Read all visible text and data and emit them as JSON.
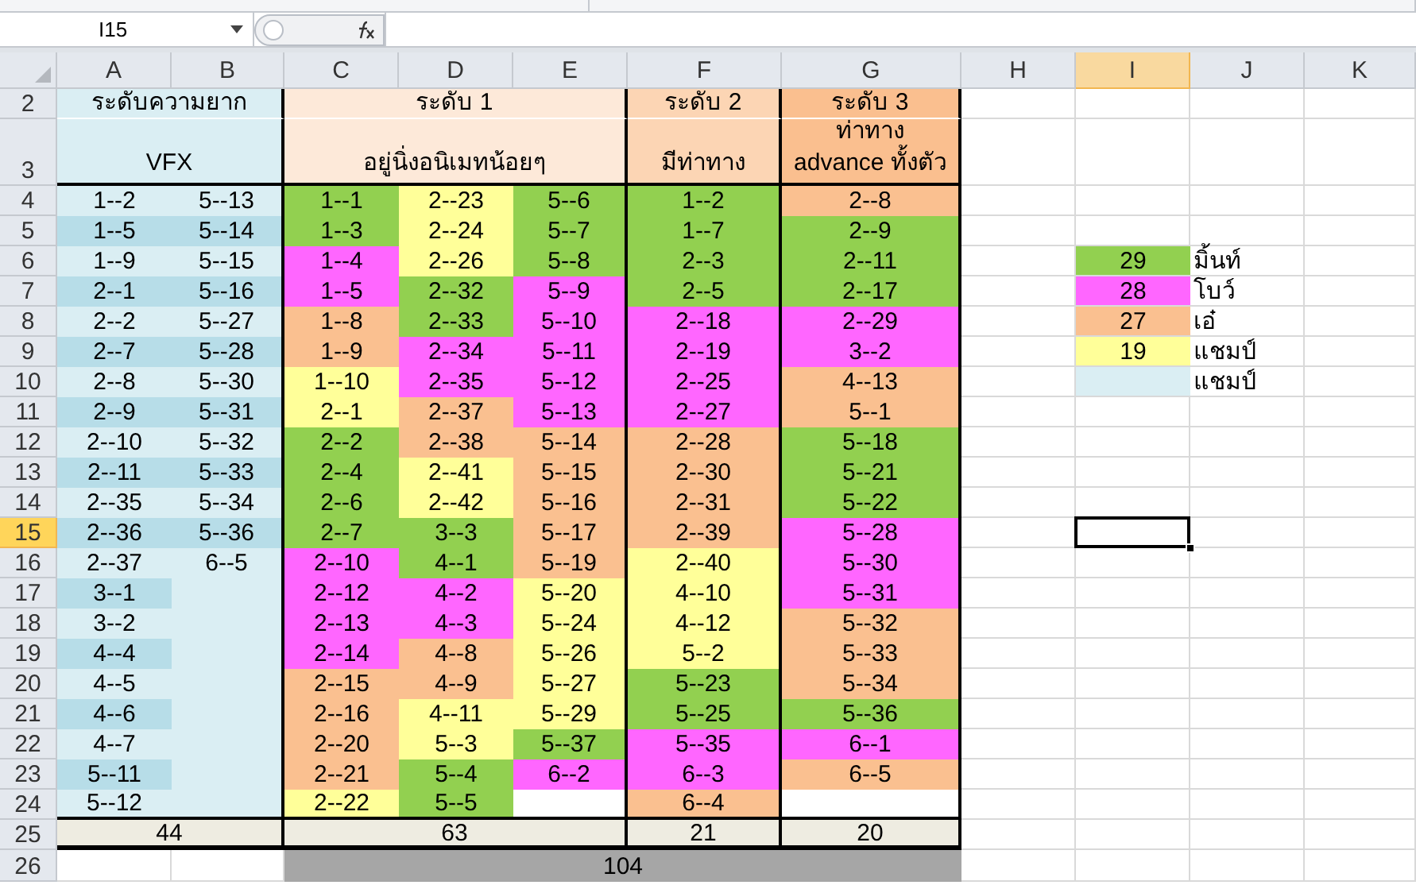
{
  "name_box": "I15",
  "column_headers": [
    {
      "label": "A",
      "selected": false
    },
    {
      "label": "B",
      "selected": false
    },
    {
      "label": "C",
      "selected": false
    },
    {
      "label": "D",
      "selected": false
    },
    {
      "label": "E",
      "selected": false
    },
    {
      "label": "F",
      "selected": false
    },
    {
      "label": "G",
      "selected": false
    },
    {
      "label": "H",
      "selected": false
    },
    {
      "label": "I",
      "selected": true
    },
    {
      "label": "J",
      "selected": false
    },
    {
      "label": "K",
      "selected": false
    }
  ],
  "row_headers": [
    {
      "label": "2",
      "selected": false
    },
    {
      "label": "3",
      "selected": false
    },
    {
      "label": "4",
      "selected": false
    },
    {
      "label": "5",
      "selected": false
    },
    {
      "label": "6",
      "selected": false
    },
    {
      "label": "7",
      "selected": false
    },
    {
      "label": "8",
      "selected": false
    },
    {
      "label": "9",
      "selected": false
    },
    {
      "label": "10",
      "selected": false
    },
    {
      "label": "11",
      "selected": false
    },
    {
      "label": "12",
      "selected": false
    },
    {
      "label": "13",
      "selected": false
    },
    {
      "label": "14",
      "selected": false
    },
    {
      "label": "15",
      "selected": true
    },
    {
      "label": "16",
      "selected": false
    },
    {
      "label": "17",
      "selected": false
    },
    {
      "label": "18",
      "selected": false
    },
    {
      "label": "19",
      "selected": false
    },
    {
      "label": "20",
      "selected": false
    },
    {
      "label": "21",
      "selected": false
    },
    {
      "label": "22",
      "selected": false
    },
    {
      "label": "23",
      "selected": false
    },
    {
      "label": "24",
      "selected": false
    },
    {
      "label": "25",
      "selected": false
    },
    {
      "label": "26",
      "selected": false
    }
  ],
  "sections": [
    {
      "title": "ระดับความยาก",
      "subtitle": "VFX",
      "color": "#daeef3",
      "total": "44",
      "columns": [
        {
          "cells": [
            {
              "text": "1--2",
              "color": "#daeef3"
            },
            {
              "text": "1--5",
              "color": "#b7dde8"
            },
            {
              "text": "1--9",
              "color": "#daeef3"
            },
            {
              "text": "2--1",
              "color": "#b7dde8"
            },
            {
              "text": "2--2",
              "color": "#daeef3"
            },
            {
              "text": "2--7",
              "color": "#b7dde8"
            },
            {
              "text": "2--8",
              "color": "#daeef3"
            },
            {
              "text": "2--9",
              "color": "#b7dde8"
            },
            {
              "text": "2--10",
              "color": "#daeef3"
            },
            {
              "text": "2--11",
              "color": "#b7dde8"
            },
            {
              "text": "2--35",
              "color": "#daeef3"
            },
            {
              "text": "2--36",
              "color": "#b7dde8"
            },
            {
              "text": "2--37",
              "color": "#daeef3"
            },
            {
              "text": "3--1",
              "color": "#b7dde8"
            },
            {
              "text": "3--2",
              "color": "#daeef3"
            },
            {
              "text": "4--4",
              "color": "#b7dde8"
            },
            {
              "text": "4--5",
              "color": "#daeef3"
            },
            {
              "text": "4--6",
              "color": "#b7dde8"
            },
            {
              "text": "4--7",
              "color": "#daeef3"
            },
            {
              "text": "5--11",
              "color": "#b7dde8"
            },
            {
              "text": "5--12",
              "color": "#daeef3"
            }
          ]
        },
        {
          "cells": [
            {
              "text": "5--13",
              "color": "#daeef3"
            },
            {
              "text": "5--14",
              "color": "#b7dde8"
            },
            {
              "text": "5--15",
              "color": "#daeef3"
            },
            {
              "text": "5--16",
              "color": "#b7dde8"
            },
            {
              "text": "5--27",
              "color": "#daeef3"
            },
            {
              "text": "5--28",
              "color": "#b7dde8"
            },
            {
              "text": "5--30",
              "color": "#daeef3"
            },
            {
              "text": "5--31",
              "color": "#b7dde8"
            },
            {
              "text": "5--32",
              "color": "#daeef3"
            },
            {
              "text": "5--33",
              "color": "#b7dde8"
            },
            {
              "text": "5--34",
              "color": "#daeef3"
            },
            {
              "text": "5--36",
              "color": "#b7dde8"
            },
            {
              "text": "6--5",
              "color": "#daeef3"
            },
            {
              "color": "#daeef3"
            },
            {
              "color": "#daeef3"
            },
            {
              "color": "#daeef3"
            },
            {
              "color": "#daeef3"
            },
            {
              "color": "#daeef3"
            },
            {
              "color": "#daeef3"
            },
            {
              "color": "#daeef3"
            },
            {
              "color": "#daeef3"
            }
          ]
        }
      ]
    },
    {
      "title": "ระดับ 1",
      "subtitle": "อยู่นิ่งอนิเมทน้อยๆ",
      "color": "#fde9d9",
      "total": "63",
      "columns": [
        {
          "cells": [
            {
              "text": "1--1",
              "color": "#92d050"
            },
            {
              "text": "1--3",
              "color": "#92d050"
            },
            {
              "text": "1--4",
              "color": "#ff66ff"
            },
            {
              "text": "1--5",
              "color": "#ff66ff"
            },
            {
              "text": "1--8",
              "color": "#fac090"
            },
            {
              "text": "1--9",
              "color": "#fac090"
            },
            {
              "text": "1--10",
              "color": "#ffff99"
            },
            {
              "text": "2--1",
              "color": "#ffff99"
            },
            {
              "text": "2--2",
              "color": "#92d050"
            },
            {
              "text": "2--4",
              "color": "#92d050"
            },
            {
              "text": "2--6",
              "color": "#92d050"
            },
            {
              "text": "2--7",
              "color": "#92d050"
            },
            {
              "text": "2--10",
              "color": "#ff66ff"
            },
            {
              "text": "2--12",
              "color": "#ff66ff"
            },
            {
              "text": "2--13",
              "color": "#ff66ff"
            },
            {
              "text": "2--14",
              "color": "#ff66ff"
            },
            {
              "text": "2--15",
              "color": "#fac090"
            },
            {
              "text": "2--16",
              "color": "#fac090"
            },
            {
              "text": "2--20",
              "color": "#fac090"
            },
            {
              "text": "2--21",
              "color": "#fac090"
            },
            {
              "text": "2--22",
              "color": "#ffff99"
            }
          ]
        },
        {
          "cells": [
            {
              "text": "2--23",
              "color": "#ffff99"
            },
            {
              "text": "2--24",
              "color": "#ffff99"
            },
            {
              "text": "2--26",
              "color": "#ffff99"
            },
            {
              "text": "2--32",
              "color": "#92d050"
            },
            {
              "text": "2--33",
              "color": "#92d050"
            },
            {
              "text": "2--34",
              "color": "#ff66ff"
            },
            {
              "text": "2--35",
              "color": "#ff66ff"
            },
            {
              "text": "2--37",
              "color": "#fac090"
            },
            {
              "text": "2--38",
              "color": "#fac090"
            },
            {
              "text": "2--41",
              "color": "#ffff99"
            },
            {
              "text": "2--42",
              "color": "#ffff99"
            },
            {
              "text": "3--3",
              "color": "#92d050"
            },
            {
              "text": "4--1",
              "color": "#92d050"
            },
            {
              "text": "4--2",
              "color": "#ff66ff"
            },
            {
              "text": "4--3",
              "color": "#ff66ff"
            },
            {
              "text": "4--8",
              "color": "#fac090"
            },
            {
              "text": "4--9",
              "color": "#fac090"
            },
            {
              "text": "4--11",
              "color": "#ffff99"
            },
            {
              "text": "5--3",
              "color": "#ffff99"
            },
            {
              "text": "5--4",
              "color": "#92d050"
            },
            {
              "text": "5--5",
              "color": "#92d050"
            }
          ]
        },
        {
          "cells": [
            {
              "text": "5--6",
              "color": "#92d050"
            },
            {
              "text": "5--7",
              "color": "#92d050"
            },
            {
              "text": "5--8",
              "color": "#92d050"
            },
            {
              "text": "5--9",
              "color": "#ff66ff"
            },
            {
              "text": "5--10",
              "color": "#ff66ff"
            },
            {
              "text": "5--11",
              "color": "#ff66ff"
            },
            {
              "text": "5--12",
              "color": "#ff66ff"
            },
            {
              "text": "5--13",
              "color": "#ff66ff"
            },
            {
              "text": "5--14",
              "color": "#fac090"
            },
            {
              "text": "5--15",
              "color": "#fac090"
            },
            {
              "text": "5--16",
              "color": "#fac090"
            },
            {
              "text": "5--17",
              "color": "#fac090"
            },
            {
              "text": "5--19",
              "color": "#fac090"
            },
            {
              "text": "5--20",
              "color": "#ffff99"
            },
            {
              "text": "5--24",
              "color": "#ffff99"
            },
            {
              "text": "5--26",
              "color": "#ffff99"
            },
            {
              "text": "5--27",
              "color": "#ffff99"
            },
            {
              "text": "5--29",
              "color": "#ffff99"
            },
            {
              "text": "5--37",
              "color": "#92d050"
            },
            {
              "text": "6--2",
              "color": "#ff66ff"
            },
            {
              "color": "#ffffff"
            }
          ]
        }
      ]
    },
    {
      "title": "ระดับ 2",
      "subtitle": "มีท่าทาง",
      "color": "#fcd5b4",
      "total": "21",
      "columns": [
        {
          "cells": [
            {
              "text": "1--2",
              "color": "#92d050"
            },
            {
              "text": "1--7",
              "color": "#92d050"
            },
            {
              "text": "2--3",
              "color": "#92d050"
            },
            {
              "text": "2--5",
              "color": "#92d050"
            },
            {
              "text": "2--18",
              "color": "#ff66ff"
            },
            {
              "text": "2--19",
              "color": "#ff66ff"
            },
            {
              "text": "2--25",
              "color": "#ff66ff"
            },
            {
              "text": "2--27",
              "color": "#ff66ff"
            },
            {
              "text": "2--28",
              "color": "#fac090"
            },
            {
              "text": "2--30",
              "color": "#fac090"
            },
            {
              "text": "2--31",
              "color": "#fac090"
            },
            {
              "text": "2--39",
              "color": "#fac090"
            },
            {
              "text": "2--40",
              "color": "#ffff99"
            },
            {
              "text": "4--10",
              "color": "#ffff99"
            },
            {
              "text": "4--12",
              "color": "#ffff99"
            },
            {
              "text": "5--2",
              "color": "#ffff99"
            },
            {
              "text": "5--23",
              "color": "#92d050"
            },
            {
              "text": "5--25",
              "color": "#92d050"
            },
            {
              "text": "5--35",
              "color": "#ff66ff"
            },
            {
              "text": "6--3",
              "color": "#ff66ff"
            },
            {
              "text": "6--4",
              "color": "#fac090"
            }
          ]
        }
      ]
    },
    {
      "title": "ระดับ 3",
      "subtitle": "ท่าทาง advance ทั้งตัว",
      "color": "#fabf8f",
      "total": "20",
      "columns": [
        {
          "cells": [
            {
              "text": "2--8",
              "color": "#fac090"
            },
            {
              "text": "2--9",
              "color": "#92d050"
            },
            {
              "text": "2--11",
              "color": "#92d050"
            },
            {
              "text": "2--17",
              "color": "#92d050"
            },
            {
              "text": "2--29",
              "color": "#ff66ff"
            },
            {
              "text": "3--2",
              "color": "#ff66ff"
            },
            {
              "text": "4--13",
              "color": "#fac090"
            },
            {
              "text": "5--1",
              "color": "#fac090"
            },
            {
              "text": "5--18",
              "color": "#92d050"
            },
            {
              "text": "5--21",
              "color": "#92d050"
            },
            {
              "text": "5--22",
              "color": "#92d050"
            },
            {
              "text": "5--28",
              "color": "#ff66ff"
            },
            {
              "text": "5--30",
              "color": "#ff66ff"
            },
            {
              "text": "5--31",
              "color": "#ff66ff"
            },
            {
              "text": "5--32",
              "color": "#fac090"
            },
            {
              "text": "5--33",
              "color": "#fac090"
            },
            {
              "text": "5--34",
              "color": "#fac090"
            },
            {
              "text": "5--36",
              "color": "#92d050"
            },
            {
              "text": "6--1",
              "color": "#ff66ff"
            },
            {
              "text": "6--5",
              "color": "#fac090"
            },
            {
              "color": "#ffffff"
            }
          ]
        }
      ]
    }
  ],
  "grand_total": "104",
  "legend": [
    {
      "count": "29",
      "label": "มิ้นท์",
      "color": "#92d050"
    },
    {
      "count": "28",
      "label": "โบว์",
      "color": "#ff66ff"
    },
    {
      "count": "27",
      "label": "เอ๋",
      "color": "#fac090"
    },
    {
      "count": "19",
      "label": "แชมป์",
      "color": "#ffff99"
    },
    {
      "label": "แชมป์",
      "color": "#daeef3"
    }
  ]
}
